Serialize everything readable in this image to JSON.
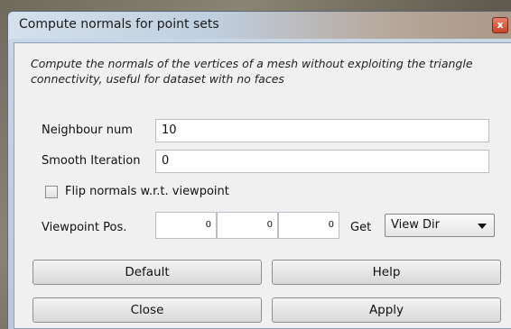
{
  "window": {
    "title": "Compute normals for point sets",
    "close_glyph": "x"
  },
  "description": "Compute the normals of the vertices of a mesh without exploiting the triangle connectivity, useful for dataset with no faces",
  "fields": {
    "neighbour_num": {
      "label": "Neighbour num",
      "value": "10"
    },
    "smooth_iteration": {
      "label": "Smooth Iteration",
      "value": "0"
    }
  },
  "flip_normals": {
    "label": "Flip normals w.r.t. viewpoint",
    "checked": false
  },
  "viewpoint": {
    "label": "Viewpoint Pos.",
    "x": "0",
    "y": "0",
    "z": "0",
    "get_label": "Get",
    "dropdown_value": "View Dir"
  },
  "buttons": {
    "default": "Default",
    "help": "Help",
    "close": "Close",
    "apply": "Apply"
  }
}
